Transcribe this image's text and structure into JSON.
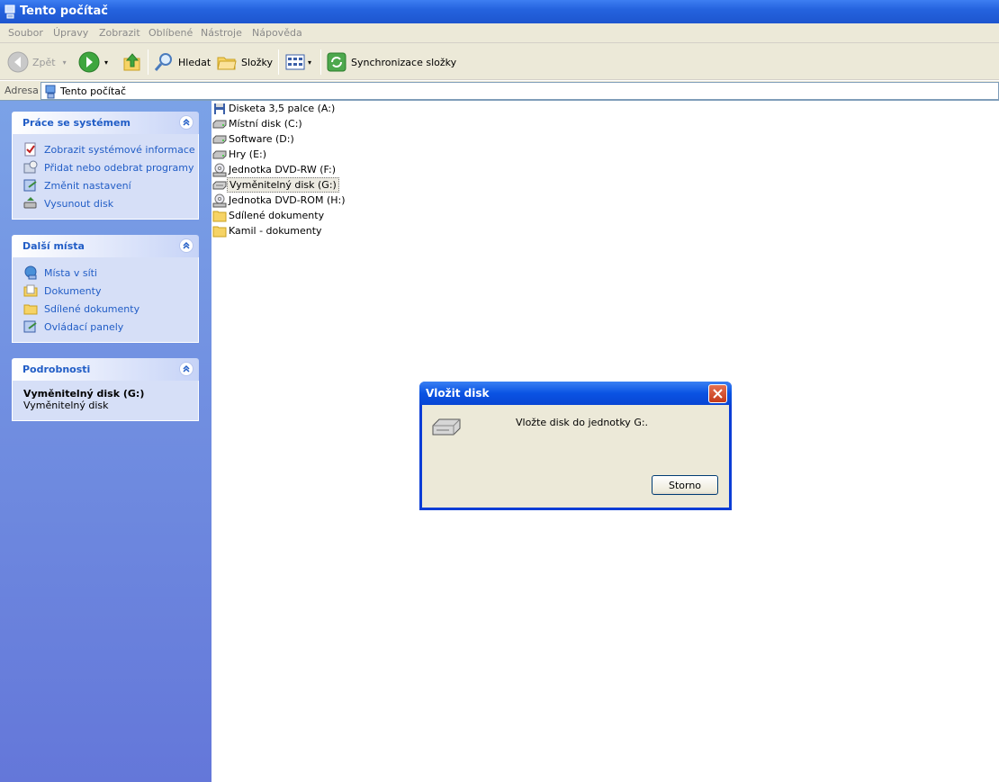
{
  "window": {
    "title": "Tento počítač"
  },
  "menu": [
    "Soubor",
    "Úpravy",
    "Zobrazit",
    "Oblíbené",
    "Nástroje",
    "Nápověda"
  ],
  "toolbar": {
    "back": "Zpět",
    "search": "Hledat",
    "folders": "Složky",
    "sync": "Synchronizace složky"
  },
  "address": {
    "label": "Adresa",
    "value": "Tento počítač"
  },
  "sidebar": {
    "system_tasks": {
      "title": "Práce se systémem",
      "items": [
        "Zobrazit systémové informace",
        "Přidat nebo odebrat programy",
        "Změnit nastavení",
        "Vysunout disk"
      ]
    },
    "other_places": {
      "title": "Další místa",
      "items": [
        "Místa v síti",
        "Dokumenty",
        "Sdílené dokumenty",
        "Ovládací panely"
      ]
    },
    "details": {
      "title": "Podrobnosti",
      "name": "Vyměnitelný disk (G:)",
      "type": "Vyměnitelný disk"
    }
  },
  "drives": [
    {
      "label": "Disketa 3,5 palce (A:)",
      "icon": "floppy-icon"
    },
    {
      "label": "Místní disk (C:)",
      "icon": "hard-disk-icon"
    },
    {
      "label": "Software (D:)",
      "icon": "hard-disk-icon"
    },
    {
      "label": "Hry (E:)",
      "icon": "hard-disk-icon"
    },
    {
      "label": "Jednotka DVD-RW (F:)",
      "icon": "dvd-drive-icon"
    },
    {
      "label": "Vyměnitelný disk (G:)",
      "icon": "removable-disk-icon",
      "selected": true
    },
    {
      "label": "Jednotka DVD-ROM (H:)",
      "icon": "dvd-drive-icon"
    },
    {
      "label": "Sdílené dokumenty",
      "icon": "folder-icon"
    },
    {
      "label": "Kamil - dokumenty",
      "icon": "folder-icon"
    }
  ],
  "dialog": {
    "title": "Vložit disk",
    "message": "Vložte disk do jednotky G:.",
    "button": "Storno"
  }
}
